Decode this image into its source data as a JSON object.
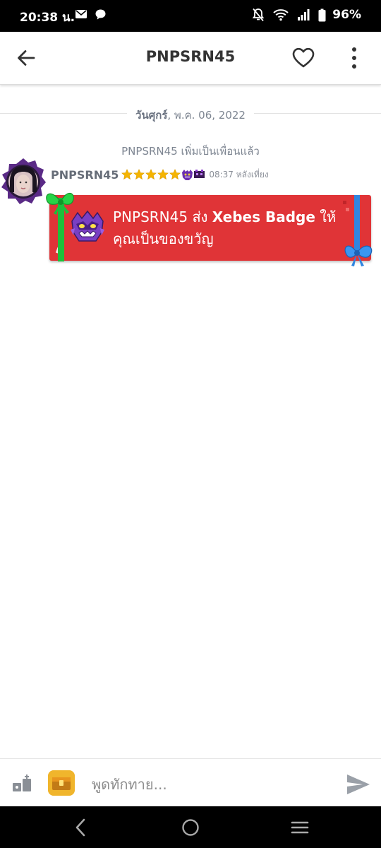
{
  "status_bar": {
    "time": "20:38 น.",
    "battery": "96%",
    "icons": [
      "mail-icon",
      "chat-bubble-icon",
      "notifications-off-icon",
      "wifi-icon",
      "signal-icon",
      "battery-icon"
    ]
  },
  "header": {
    "title": "PNPSRN45",
    "icons": [
      "back-arrow-icon",
      "heart-icon",
      "more-vert-icon"
    ]
  },
  "conversation": {
    "date_day": "วันศุกร์",
    "date_rest": ", พ.ค. 06, 2022",
    "system_message": "PNPSRN45 เพิ่มเป็นเพื่อนแล้ว",
    "message": {
      "sender": "PNPSRN45",
      "star_count": 5,
      "time": "08:37 หลังเที่ยง",
      "gift_prefix": "PNPSRN45 ส่ง ",
      "gift_item": "Xebes Badge",
      "gift_suffix": " ให้คุณเป็นของขวัญ"
    }
  },
  "composer": {
    "placeholder": "พูดทักทาย...",
    "value": ""
  },
  "colors": {
    "gift_card": "#e03437",
    "ribbon_green": "#1fbf3a",
    "ribbon_blue": "#2f86e0",
    "star": "#f5b400",
    "badge_purple": "#7a3fc4"
  },
  "nav_bar": {
    "icons": [
      "nav-back-icon",
      "nav-home-icon",
      "nav-recents-icon"
    ]
  }
}
